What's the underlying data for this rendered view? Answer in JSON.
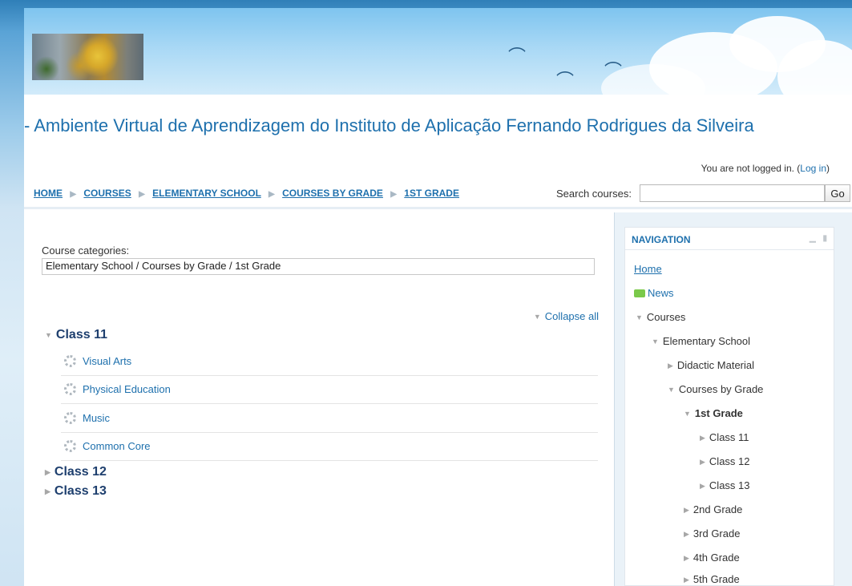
{
  "header": {
    "site_title": "- Ambiente Virtual de Aprendizagem do Instituto de Aplicação Fernando Rodrigues da Silveira",
    "login_text": "You are not logged in. (",
    "login_link": "Log in",
    "login_close": ")"
  },
  "breadcrumb": {
    "items": [
      "HOME",
      "COURSES",
      "ELEMENTARY SCHOOL",
      "COURSES BY GRADE",
      "1ST GRADE"
    ],
    "separator": "▶"
  },
  "search": {
    "label": "Search courses:",
    "value": "",
    "button": "Go"
  },
  "main": {
    "categories_label": "Course categories:",
    "category_selected": "Elementary School / Courses by Grade / 1st Grade",
    "collapse_all": "Collapse all",
    "classes": [
      {
        "name": "Class 11",
        "expanded": true,
        "courses": [
          "Visual Arts",
          "Physical Education",
          "Music",
          "Common Core"
        ]
      },
      {
        "name": "Class 12",
        "expanded": false
      },
      {
        "name": "Class 13",
        "expanded": false
      }
    ]
  },
  "navigation": {
    "title": "NAVIGATION",
    "home": "Home",
    "news": "News",
    "courses": "Courses",
    "elementary_school": "Elementary School",
    "didactic_material": "Didactic Material",
    "courses_by_grade": "Courses by Grade",
    "first_grade": "1st Grade",
    "class_11": "Class 11",
    "class_12": "Class 12",
    "class_13": "Class 13",
    "second_grade": "2nd Grade",
    "third_grade": "3rd Grade",
    "fourth_grade": "4th Grade",
    "fifth_grade": "5th Grade"
  },
  "icons": {
    "expanded": "triangle-down-icon",
    "collapsed": "triangle-right-icon",
    "course": "course-icon",
    "news": "news-icon"
  },
  "colors": {
    "link": "#1e70ad",
    "heading": "#1e3f6e",
    "banner_sky": "#7ec4ef"
  }
}
